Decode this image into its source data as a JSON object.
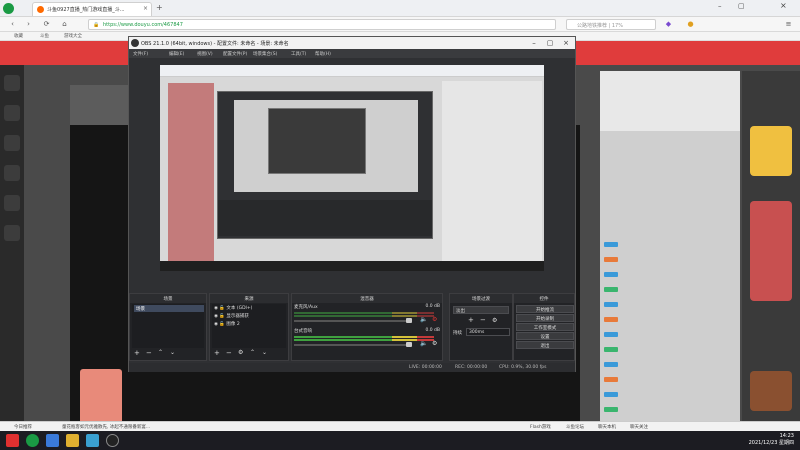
{
  "browser": {
    "tab_title": "斗鱼0927直播_热门游戏直播_斗...",
    "url": "https://www.douyu.com/467847",
    "search_placeholder": "公路地铁推荐 | 17%",
    "bookmarks": [
      "收藏",
      "斗鱼",
      "游戏大全"
    ]
  },
  "obs": {
    "title": "OBS 21.1.0 (64bit, windows) - 配置文件: 未命名 - 场景: 未命名",
    "menu": [
      "文件(F)",
      "编辑(E)",
      "视图(V)",
      "配置文件(P)",
      "场景集合(S)",
      "工具(T)",
      "帮助(H)"
    ],
    "docks": {
      "scenes": {
        "title": "场景",
        "items": [
          "场景"
        ]
      },
      "sources": {
        "title": "来源",
        "items": [
          "文本 (GDI+)",
          "显示器捕获",
          "图像 2"
        ]
      },
      "mixer": {
        "title": "混音器",
        "tracks": [
          {
            "name": "麦克风/Aux",
            "db": "0.0 dB",
            "level": 0.55
          },
          {
            "name": "台式音响",
            "db": "0.0 dB",
            "level": 0.85
          }
        ]
      },
      "transitions": {
        "title": "场景过渡",
        "type": "淡出",
        "duration_label": "持续",
        "duration": "300ms"
      },
      "controls": {
        "title": "控件",
        "buttons": [
          "开始推流",
          "开始录制",
          "工作室模式",
          "设置",
          "退出"
        ]
      }
    },
    "status": {
      "live": "LIVE: 00:00:00",
      "rec": "REC: 00:00:00",
      "cpu": "CPU: 0.9%, 30.00 fps"
    }
  },
  "page_bottom": {
    "left": "今日推荐",
    "news": "童花瓶客如元优雅散先, 冰起不通限番新宴...",
    "right": [
      "Flash游戏",
      "斗鱼论坛",
      "聊天本机",
      "聊天关注"
    ]
  },
  "taskbar": {
    "time": "14:23",
    "date": "2021/12/23 星期四"
  },
  "colors": {
    "douyu_red": "#e03c3c",
    "obs_bg": "#2f3033",
    "accent_green": "#1a9a44"
  }
}
